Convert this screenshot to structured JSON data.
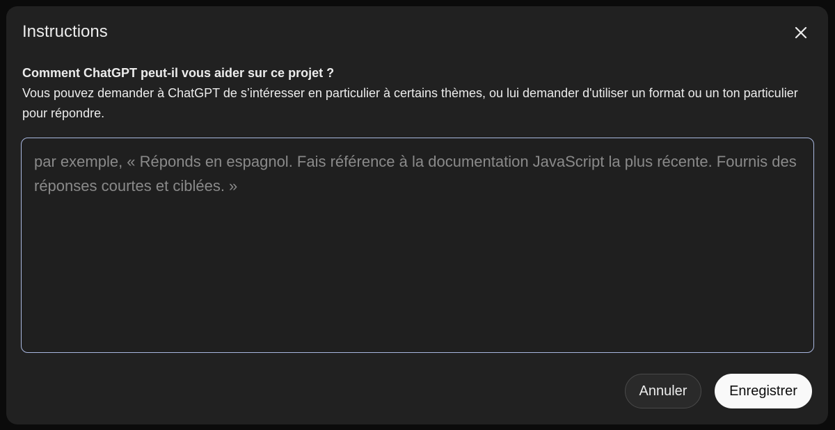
{
  "dialog": {
    "title": "Instructions",
    "question": "Comment ChatGPT peut-il vous aider sur ce projet ?",
    "description": "Vous pouvez demander à ChatGPT de s’intéresser en particulier à certains thèmes, ou lui demander d'utiliser un format ou un ton particulier pour répondre.",
    "instructions_input": {
      "value": "",
      "placeholder": "par exemple, « Réponds en espagnol. Fais référence à la documentation JavaScript la plus récente. Fournis des réponses courtes et ciblées. »"
    },
    "cancel_label": "Annuler",
    "save_label": "Enregistrer"
  },
  "icons": {
    "close": "close-icon"
  },
  "colors": {
    "modal_background": "#212121",
    "focus_border": "#a9b8e0",
    "primary_button": "#f9f9f9",
    "secondary_button": "#2a2a2a"
  }
}
